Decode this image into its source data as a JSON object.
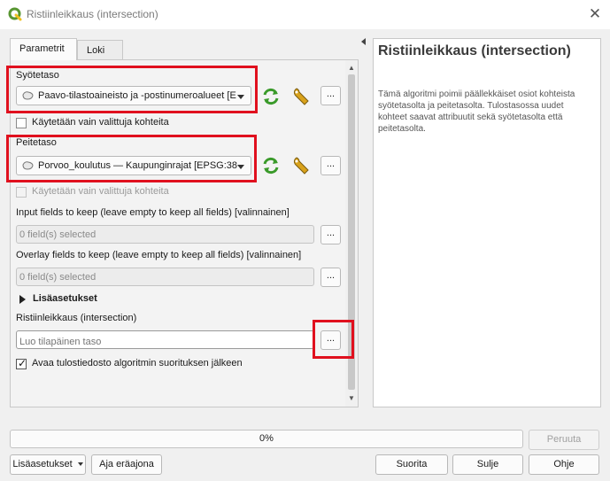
{
  "window": {
    "title": "Ristiinleikkaus (intersection)",
    "close_symbol": "✕",
    "icon": "qgis-icon"
  },
  "tabs": [
    {
      "label": "Parametrit",
      "active": true
    },
    {
      "label": "Loki",
      "active": false
    }
  ],
  "params": {
    "input_layer": {
      "label": "Syötetaso",
      "value": "Paavo-tilastoaineisto ja -postinumeroalueet [E",
      "selected_only_label": "Käytetään vain valittuja kohteita"
    },
    "overlay_layer": {
      "label": "Peitetaso",
      "value": "Porvoo_koulutus — Kaupunginrajat [EPSG:38",
      "selected_only_label": "Käytetään vain valittuja kohteita"
    },
    "input_fields": {
      "label": "Input fields to keep (leave empty to keep all fields) [valinnainen]",
      "value": "0 field(s) selected"
    },
    "overlay_fields": {
      "label": "Overlay fields to keep (leave empty to keep all fields) [valinnainen]",
      "value": "0 field(s) selected"
    },
    "advanced_label": "Lisäasetukset",
    "output": {
      "label": "Ristiinleikkaus (intersection)",
      "placeholder": "Luo tilapäinen taso"
    },
    "open_output_label": "Avaa tulostiedosto algoritmin suorituksen jälkeen",
    "dots_label": "...",
    "check_mark": "✓"
  },
  "help": {
    "title": "Ristiinleikkaus (intersection)",
    "body": "Tämä algoritmi poimii päällekkäiset osiot kohteista syötetasolta ja peitetasolta. Tulostasossa uudet kohteet saavat attribuutit sekä syötetasolta että peitetasolta."
  },
  "progress": {
    "value": 0,
    "label": "0%"
  },
  "buttons": {
    "cancel": "Peruuta",
    "advanced": "Lisäasetukset",
    "batch": "Aja eräajona",
    "run": "Suorita",
    "close": "Sulje",
    "help": "Ohje"
  },
  "colors": {
    "highlight": "#e0101e",
    "qgis_green": "#589632",
    "qgis_yellow": "#f0c01f"
  }
}
